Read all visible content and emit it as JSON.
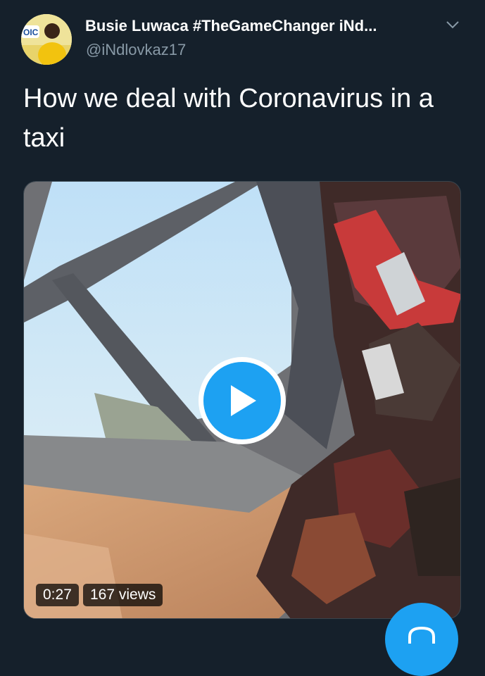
{
  "tweet": {
    "display_name": "Busie Luwaca #TheGameChanger iNd...",
    "handle": "@iNdlovkaz17",
    "text": "How we deal with Coronavirus in a taxi",
    "avatar_icon": "profile-avatar",
    "menu_icon": "chevron-down-icon"
  },
  "video": {
    "duration": "0:27",
    "views": "167 views",
    "play_icon": "play-icon"
  },
  "compose": {
    "icon": "compose-icon"
  },
  "colors": {
    "background": "#15202b",
    "accent": "#1da1f2",
    "secondary_text": "#8899a6"
  }
}
